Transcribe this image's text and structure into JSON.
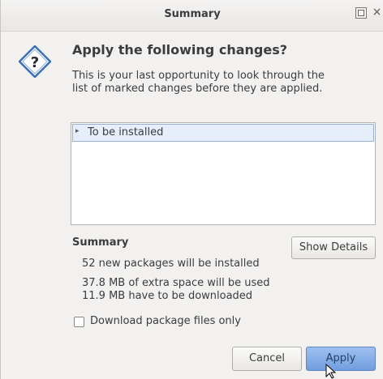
{
  "window": {
    "title": "Summary",
    "close_glyph": "×"
  },
  "dialog": {
    "heading": "Apply the following changes?",
    "description": "This is your last opportunity to look through the list of marked changes before they are applied.",
    "icon": "question-diamond-icon"
  },
  "changes_list": {
    "items": [
      {
        "label": "To be installed",
        "expander": "▸"
      }
    ]
  },
  "summary": {
    "title": "Summary",
    "show_details_label": "Show Details",
    "lines": [
      "52 new packages will be installed",
      "37.8 MB of extra space will be used",
      "11.9 MB have to be downloaded"
    ]
  },
  "options": {
    "download_only_label": "Download package files only",
    "download_only_checked": false
  },
  "buttons": {
    "cancel_label": "Cancel",
    "apply_label": "Apply"
  },
  "colors": {
    "selection_bg": "#e6eefa",
    "apply_button": "#7ea8e3",
    "dialog_bg": "#f2f1f0"
  }
}
